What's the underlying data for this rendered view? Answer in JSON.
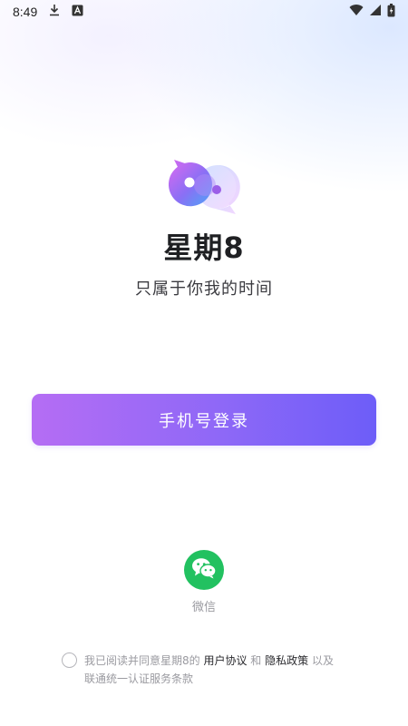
{
  "status_bar": {
    "time": "8:49",
    "icons": [
      "download-icon",
      "a-notification-icon",
      "wifi-icon",
      "signal-icon",
      "battery-icon"
    ]
  },
  "app": {
    "name": "星期8",
    "slogan": "只属于你我的时间"
  },
  "login": {
    "phone_button_label": "手机号登录",
    "wechat_label": "微信"
  },
  "agreement": {
    "prefix": "我已阅读并同意星期8的 ",
    "user_agreement": "用户协议",
    "and": " 和 ",
    "privacy_policy": "隐私政策",
    "suffix": " 以及 联通统一认证服务条款"
  },
  "colors": {
    "primary_gradient_start": "#b56df4",
    "primary_gradient_end": "#6d5df8",
    "wechat_green": "#22c160"
  }
}
